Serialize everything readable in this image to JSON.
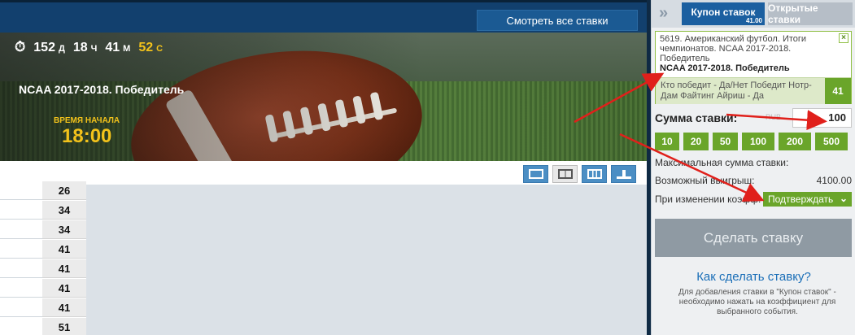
{
  "topbar": {
    "view_all_label": "Смотреть все ставки"
  },
  "event": {
    "timer": {
      "days": "152",
      "days_unit": "Д",
      "hours": "18",
      "hours_unit": "Ч",
      "minutes": "41",
      "minutes_unit": "М",
      "seconds": "52",
      "seconds_unit": "С"
    },
    "title": "NCAA 2017-2018. Победитель",
    "start_label": "Время начала",
    "start_time": "18:00"
  },
  "odds_list": [
    "26",
    "34",
    "34",
    "41",
    "41",
    "41",
    "41",
    "51"
  ],
  "panel": {
    "tab_coupon": "Купон ставок",
    "tab_coupon_badge": "41.00",
    "tab_open": "Открытые ставки",
    "bet": {
      "description": "5619. Американский футбол. Итоги чемпионатов. NCAA 2017-2018. Победитель",
      "event_name": "NCAA 2017-2018. Победитель",
      "pick": "Кто победит - Да/Нет Победит Нотр-Дам Файтинг Айриш - Да",
      "odd": "41"
    },
    "stake_label": "Сумма ставки:",
    "stake_currency": "RUB",
    "stake_value": "100",
    "quick_amounts": [
      "10",
      "20",
      "50",
      "100",
      "200",
      "500"
    ],
    "max_stake_label": "Максимальная сумма ставки:",
    "possible_win_label": "Возможный выигрыш:",
    "possible_win_value": "4100.00",
    "odds_change_label": "При изменении коэфф:",
    "odds_change_option": "Подтверждать",
    "place_bet_label": "Сделать ставку",
    "how_to_label": "Как сделать ставку?",
    "help_text": "Для добавления ставки в \"Купон ставок\" - необходимо нажать на коэффициент для выбранного события."
  },
  "colors": {
    "accent_blue": "#1b5fa0",
    "accent_green": "#6aa52a",
    "timer_yellow": "#f2c21b",
    "arrow_red": "#e0201b"
  }
}
